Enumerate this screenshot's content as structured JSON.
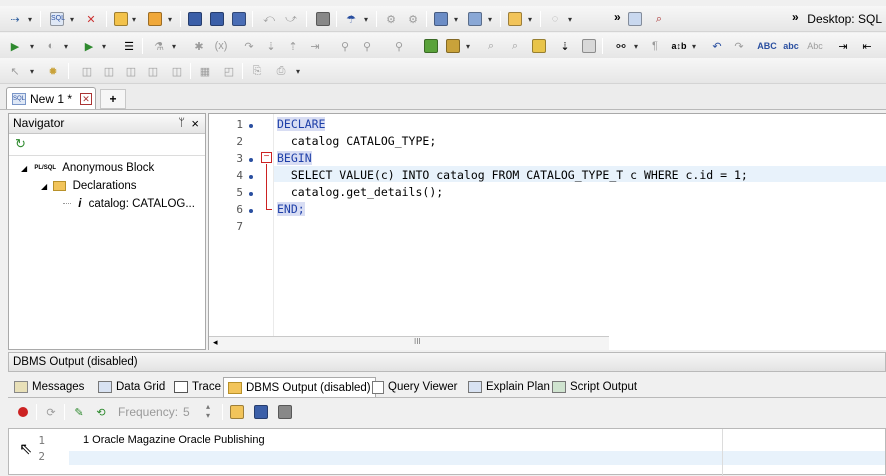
{
  "toolbar": {
    "desktop_label": "Desktop:",
    "desktop_value": "SQL",
    "overflow_label": "»"
  },
  "tabs": {
    "document_tab_label": "New 1 *",
    "add_tab_label": "+"
  },
  "navigator": {
    "title": "Navigator",
    "pin_label": "ᛘ",
    "close_label": "×",
    "tree": [
      {
        "label": "Anonymous Block",
        "prefix": "PL/SQL"
      },
      {
        "label": "Declarations"
      },
      {
        "label": "catalog: CATALOG..."
      }
    ]
  },
  "editor": {
    "line_numbers": [
      "1",
      "2",
      "3",
      "4",
      "5",
      "6",
      "7"
    ],
    "lines": [
      {
        "text": "DECLARE"
      },
      {
        "text": "  catalog CATALOG_TYPE;"
      },
      {
        "text": "BEGIN"
      },
      {
        "text": "  SELECT VALUE(c) INTO catalog FROM CATALOG_TYPE_T c WHERE c.id = 1;"
      },
      {
        "text": "  catalog.get_details();"
      },
      {
        "text": "END;"
      },
      {
        "text": ""
      }
    ],
    "scroll_label": "III"
  },
  "dbms": {
    "header": "DBMS Output (disabled)",
    "tabs": [
      "Messages",
      "Data Grid",
      "Trace",
      "DBMS Output (disabled)",
      "Query Viewer",
      "Explain Plan",
      "Script Output"
    ],
    "frequency_label": "Frequency:",
    "frequency_value": "5",
    "output_line_numbers": [
      "1",
      "2"
    ],
    "output_lines": [
      "1 Oracle Magazine Oracle Publishing",
      ""
    ]
  },
  "colors": {
    "keyword": "#1e3fa8",
    "type": "#7a7a00",
    "highlight_line": "#e8f2fb"
  }
}
